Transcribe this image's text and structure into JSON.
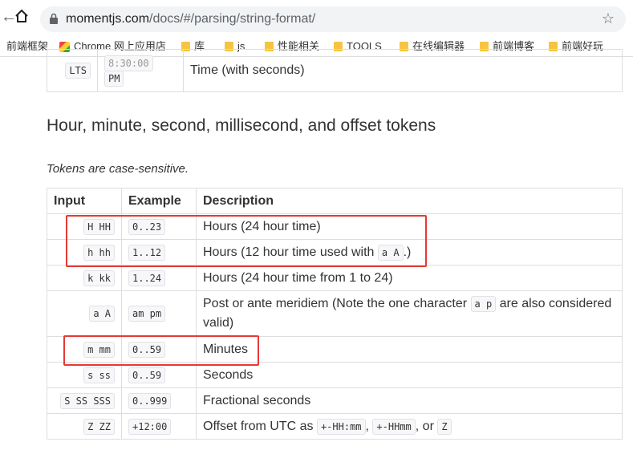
{
  "browser": {
    "url_host": "momentjs.com",
    "url_path": "/docs/#/parsing/string-format/",
    "bookmarks": [
      {
        "label": "前端框架",
        "icon": "none"
      },
      {
        "label": "Chrome 网上应用店",
        "icon": "apps-icon"
      },
      {
        "label": "库",
        "icon": "folder-icon"
      },
      {
        "label": "js",
        "icon": "folder-icon"
      },
      {
        "label": "性能相关",
        "icon": "folder-icon"
      },
      {
        "label": "TOOLS",
        "icon": "folder-icon"
      },
      {
        "label": "在线编辑器",
        "icon": "folder-icon"
      },
      {
        "label": "前端博客",
        "icon": "folder-icon"
      },
      {
        "label": "前端好玩",
        "icon": "folder-icon"
      }
    ]
  },
  "prev_row": {
    "token": "LTS",
    "example_line1": "8:30:00",
    "example_line2": "PM",
    "description": "Time (with seconds)"
  },
  "section_title": "Hour, minute, second, millisecond, and offset tokens",
  "note": "Tokens are case-sensitive.",
  "table": {
    "headers": {
      "input": "Input",
      "example": "Example",
      "description": "Description"
    },
    "rows": [
      {
        "token": "H HH",
        "example": "0..23",
        "description": "Hours (24 hour time)"
      },
      {
        "token": "h hh",
        "example": "1..12",
        "desc_pre": "Hours (12 hour time used with ",
        "desc_code": "a A",
        "desc_post": ".)"
      },
      {
        "token": "k kk",
        "example": "1..24",
        "description": "Hours (24 hour time from 1 to 24)"
      },
      {
        "token": "a A",
        "example": "am pm",
        "desc_pre": "Post or ante meridiem (Note the one character ",
        "desc_code": "a p",
        "desc_post": " are also considered valid)"
      },
      {
        "token": "m mm",
        "example": "0..59",
        "description": "Minutes"
      },
      {
        "token": "s ss",
        "example": "0..59",
        "description": "Seconds"
      },
      {
        "token": "S SS SSS",
        "example": "0..999",
        "description": "Fractional seconds"
      },
      {
        "token": "Z ZZ",
        "example": "+12:00",
        "desc_pre": "Offset from UTC as ",
        "desc_code": "+-HH:mm",
        "desc_mid": ", ",
        "desc_code2": "+-HHmm",
        "desc_mid2": ", or ",
        "desc_code3": "Z"
      }
    ]
  },
  "annotation_color": "#e53935"
}
